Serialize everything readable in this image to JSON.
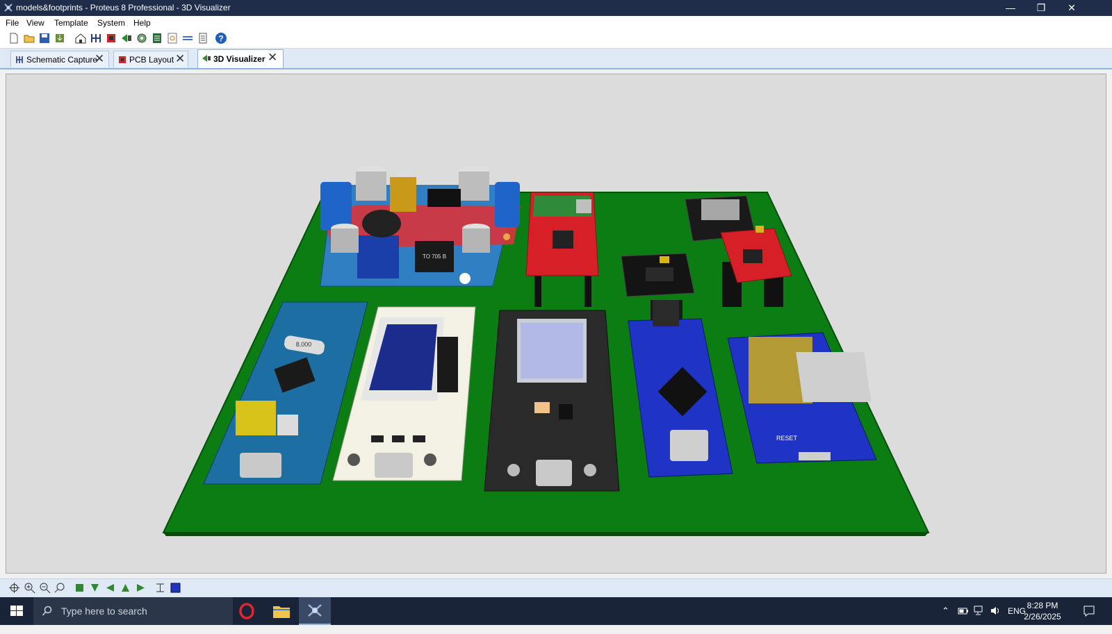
{
  "window": {
    "title": "models&footprints - Proteus 8 Professional - 3D Visualizer",
    "icons": {
      "minimize": "minimize-icon",
      "restore": "restore-icon",
      "close": "close-icon"
    }
  },
  "menu": {
    "items": [
      "File",
      "View",
      "Template",
      "System",
      "Help"
    ]
  },
  "toolbar": {
    "buttons": [
      "new-file-icon",
      "open-file-icon",
      "save-icon",
      "import-icon",
      "home-icon",
      "schematic-icon",
      "pcb-icon",
      "3d-visualizer-icon",
      "gerber-icon",
      "bom-icon",
      "design-explorer-icon",
      "netlist-icon",
      "notes-icon",
      "help-icon"
    ]
  },
  "tabs": [
    {
      "label": "Schematic Capture",
      "icon": "schematic-icon",
      "active": false
    },
    {
      "label": "PCB Layout",
      "icon": "pcb-icon",
      "active": false
    },
    {
      "label": "3D Visualizer",
      "icon": "3d-visualizer-icon",
      "active": true
    }
  ],
  "board": {
    "color": "#0a7a10",
    "modules": [
      {
        "name": "dc-dc-buck-converter",
        "label": "TO 705 B"
      },
      {
        "name": "stm32-blue-pill",
        "label": "8.000"
      },
      {
        "name": "oled-esp32-board",
        "label": ""
      },
      {
        "name": "esp32-devkit",
        "label": ""
      },
      {
        "name": "arduino-nano",
        "label": ""
      },
      {
        "name": "wemos-d1-mini",
        "label": "RESET"
      },
      {
        "name": "red-breakout-module",
        "label": ""
      },
      {
        "name": "black-sensor-module",
        "label": ""
      },
      {
        "name": "micro-sd-module",
        "label": ""
      }
    ]
  },
  "bottom_toolbar": {
    "buttons": [
      "pan-icon",
      "zoom-in-icon",
      "zoom-out-icon",
      "zoom-extents-icon",
      "view-top-icon",
      "view-front-icon",
      "view-left-icon",
      "view-back-icon",
      "view-right-icon",
      "height-icon",
      "layer-icon"
    ]
  },
  "taskbar": {
    "search_placeholder": "Type here to search",
    "apps": [
      "opera-icon",
      "file-explorer-icon",
      "proteus-icon"
    ],
    "tray": {
      "language": "ENG",
      "time": "8:28 PM",
      "date": "2/26/2025"
    }
  }
}
